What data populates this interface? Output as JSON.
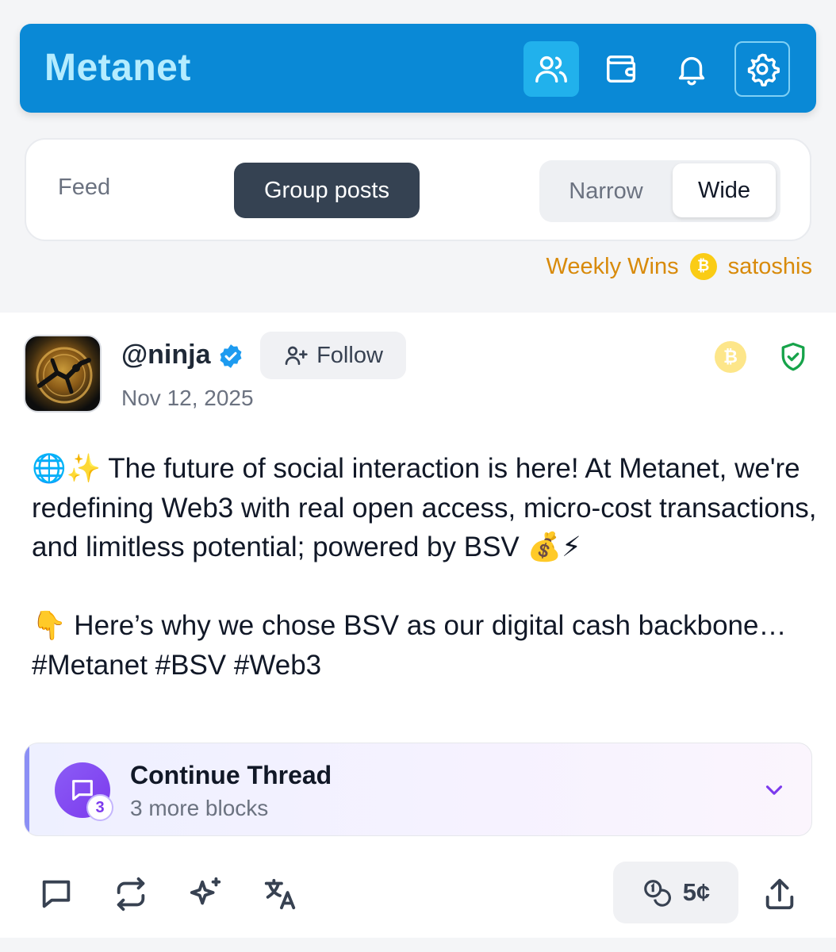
{
  "header": {
    "brand": "Metanet",
    "icons": [
      "users-icon",
      "wallet-icon",
      "bell-icon",
      "settings-icon"
    ]
  },
  "tabs": {
    "feed": "Feed",
    "group_posts": "Group posts",
    "active": "Group posts"
  },
  "layout_toggle": {
    "narrow": "Narrow",
    "wide": "Wide",
    "selected": "Wide"
  },
  "weekly": {
    "label": "Weekly Wins",
    "coin": "₿",
    "unit": "satoshis"
  },
  "post": {
    "handle": "@ninja",
    "follow_label": "Follow",
    "date": "Nov 12, 2025",
    "coin": "₿",
    "text": "🌐✨ The future of social interaction is here! At Metanet, we're redefining Web3 with real open access, micro-cost transactions, and limitless potential; powered by BSV 💰⚡\n\n👇 Here’s why we chose BSV as our digital cash backbone… #Metanet #BSV #Web3",
    "thread": {
      "title": "Continue Thread",
      "subtitle": "3 more blocks",
      "count": "3"
    },
    "tip_amount": "5¢"
  },
  "colors": {
    "header_bg": "#0a89d6",
    "brand_text": "#b4ecff",
    "active_tab_bg": "#354252",
    "weekly_text": "#d88a0a",
    "verified": "#1d9bf0",
    "shield": "#16a34a",
    "thread_accent": "#7c3aed"
  }
}
